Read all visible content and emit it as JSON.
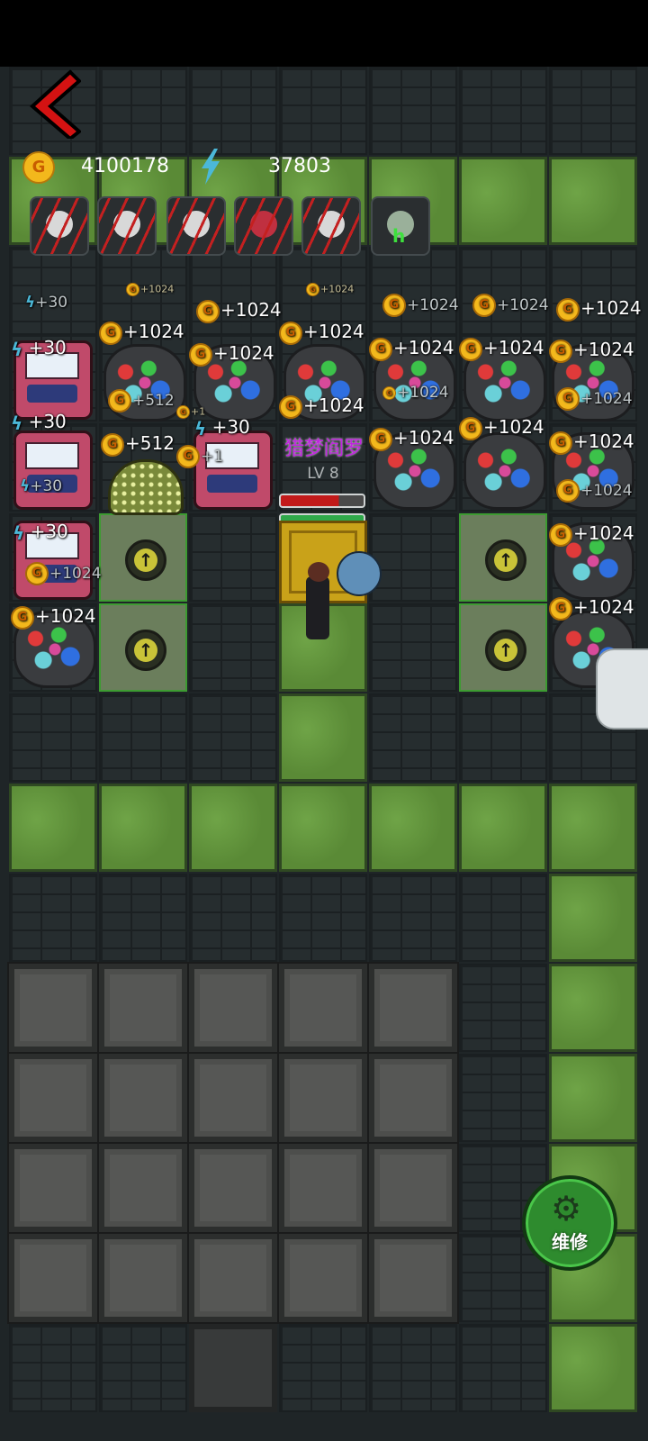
{
  "hud": {
    "coin_icon_label": "G",
    "gold": "4100178",
    "energy": "37803"
  },
  "colors": {
    "grass": "#5f8f3b",
    "wall": "#262d2f",
    "gold_coin": "#f3b81c",
    "energy_bolt": "#4bb8d8",
    "player_name": "#c024e0",
    "repair_button": "#2e8b2e",
    "back_arrow": "#d41212"
  },
  "enemies": [
    {
      "icon": "ghost-claw-icon"
    },
    {
      "icon": "panda-claw-icon"
    },
    {
      "icon": "ghost-claw-icon"
    },
    {
      "icon": "red-demon-claw-icon"
    },
    {
      "icon": "ghost-claw-icon"
    },
    {
      "icon": "green-zombie-icon",
      "badge": "h"
    }
  ],
  "player": {
    "name": "猎梦阎罗",
    "level": "LV 8",
    "health_fraction": 0.7,
    "energy_fraction": 1.0
  },
  "floats": {
    "e30": "+30",
    "g1024": "+1024",
    "g512": "+512",
    "p1": "+1"
  },
  "repair": {
    "label": "维修",
    "icon": "wrench-gear-icon"
  }
}
